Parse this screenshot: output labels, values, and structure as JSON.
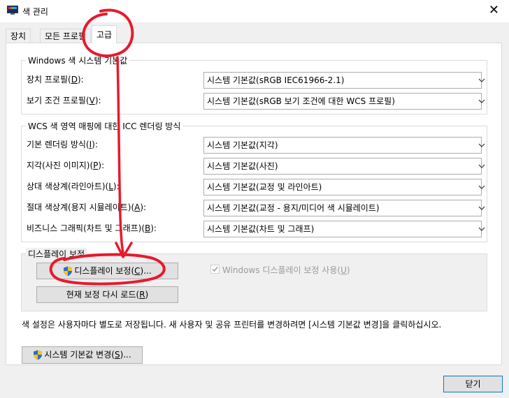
{
  "window": {
    "title": "색 관리",
    "close_glyph": "✕"
  },
  "tabs": [
    {
      "label": "장치"
    },
    {
      "label": "모든 프로필"
    },
    {
      "label": "고급"
    }
  ],
  "windows_defaults": {
    "legend": "Windows 색 시스템 기본값",
    "rows": [
      {
        "label_pre": "장치 프로필(",
        "key": "D",
        "label_post": "):",
        "value": "시스템 기본값(sRGB IEC61966-2.1)"
      },
      {
        "label_pre": "보기 조건 프로필(",
        "key": "V",
        "label_post": "):",
        "value": "시스템 기본값(sRGB 보기 조건에 대한 WCS 프로필)"
      }
    ]
  },
  "icc_mapping": {
    "legend": "WCS 색 영역 매핑에 대한 ICC 렌더링 방식",
    "rows": [
      {
        "label_pre": "기본 렌더링 방식(",
        "key": "I",
        "label_post": "):",
        "value": "시스템 기본값(지각)"
      },
      {
        "label_pre": "지각(사진 이미지)(",
        "key": "P",
        "label_post": "):",
        "value": "시스템 기본값(사진)"
      },
      {
        "label_pre": "상대 색상계(라인아트)(",
        "key": "L",
        "label_post": "):",
        "value": "시스템 기본값(교정 및 라인아트)"
      },
      {
        "label_pre": "절대 색상계(용지 시뮬레이트)(",
        "key": "A",
        "label_post": "):",
        "value": "시스템 기본값(교정 - 용지/미디어 색 시뮬레이트)"
      },
      {
        "label_pre": "비즈니스 그래픽(차트 및 그래프)(",
        "key": "B",
        "label_post": "):",
        "value": "시스템 기본값(차트 및 그래프)"
      }
    ]
  },
  "display_calibration": {
    "legend": "디스플레이 보정",
    "calibrate_pre": "디스플레이 보정(",
    "calibrate_key": "C",
    "calibrate_post": ")...",
    "reload_pre": "현재 보정 다시 로드(",
    "reload_key": "R",
    "reload_post": ")",
    "use_cal_pre": "Windows 디스플레이 보정 사용(",
    "use_cal_key": "U",
    "use_cal_post": ")",
    "use_cal_checked": true
  },
  "footnote": "색 설정은 사용자마다 별도로 저장됩니다. 새 사용자 및 공유 프린터를 변경하려면 [시스템 기본값 변경]을 클릭하십시오.",
  "change_defaults": {
    "pre": "시스템 기본값 변경(",
    "key": "S",
    "post": ")..."
  },
  "close_button": "닫기",
  "colors": {
    "annotation": "#e8192c",
    "accent": "#0078d7"
  }
}
